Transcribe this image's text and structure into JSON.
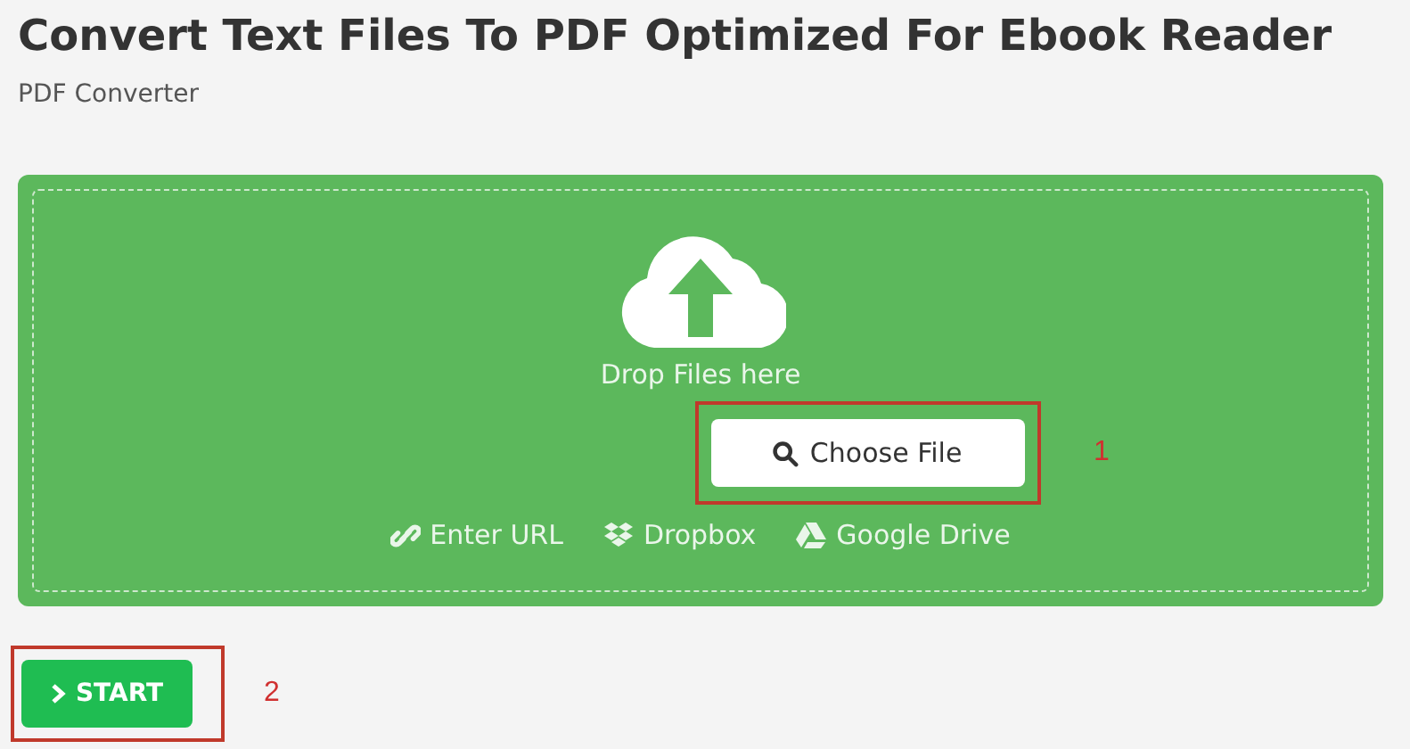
{
  "title": "Convert Text Files To PDF Optimized For Ebook Reader",
  "subtitle": "PDF Converter",
  "dropzone": {
    "prompt": "Drop Files here",
    "choose_button": {
      "label": "Choose File",
      "annotation": "1"
    },
    "sources": [
      {
        "kind": "url",
        "label": "Enter URL"
      },
      {
        "kind": "dropbox",
        "label": "Dropbox"
      },
      {
        "kind": "drive",
        "label": "Google Drive"
      }
    ]
  },
  "start_button": {
    "label": "START",
    "annotation": "2"
  }
}
